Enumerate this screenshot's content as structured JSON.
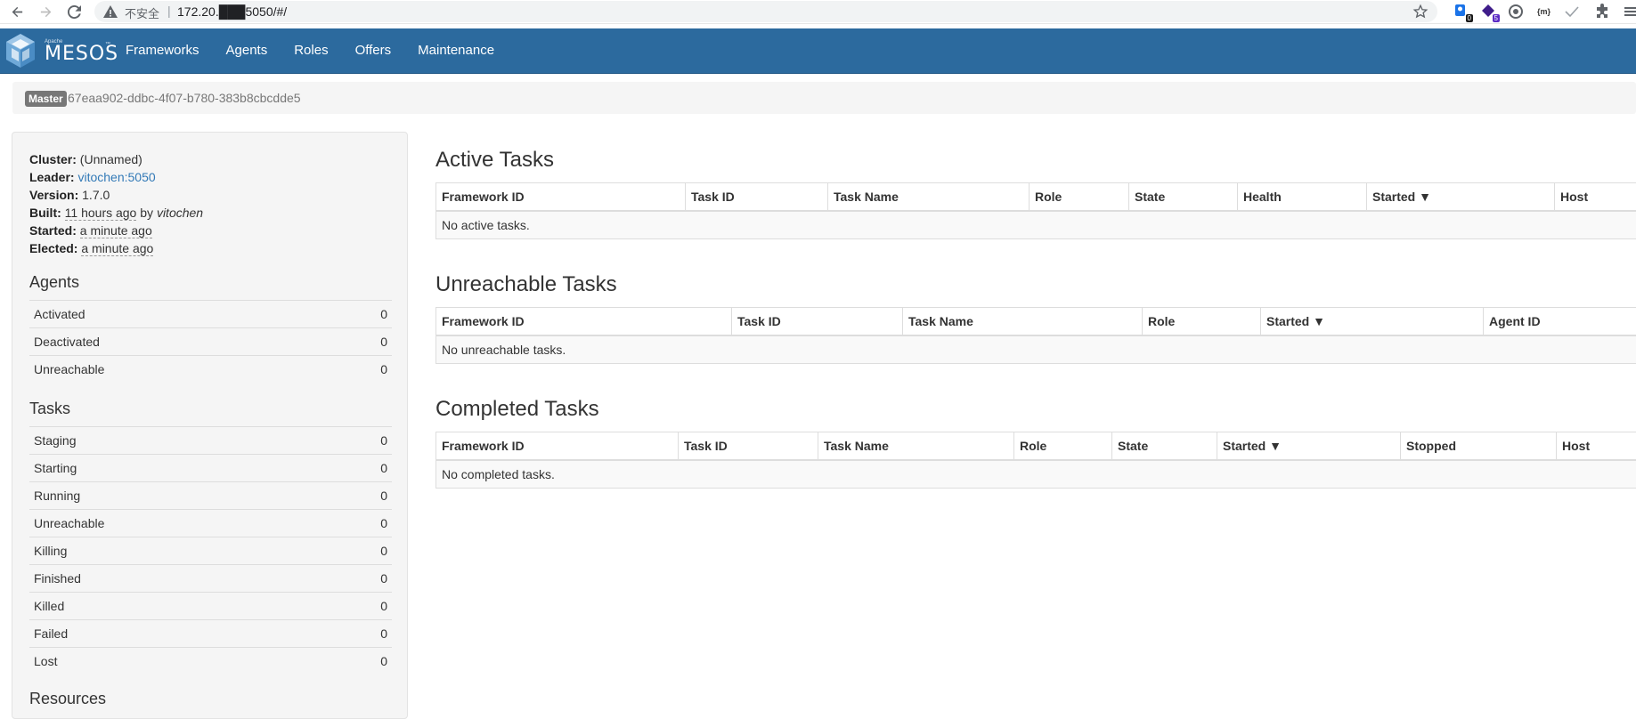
{
  "browser": {
    "insecure_label": "不安全",
    "url": "172.20.███5050/#/",
    "extensions": [
      {
        "icon": "extension-blue-icon",
        "badge": "0"
      },
      {
        "icon": "extension-purple-icon",
        "badge": "5"
      },
      {
        "icon": "extension-circle-icon"
      },
      {
        "icon": "extension-braces-icon",
        "text": "{m}"
      },
      {
        "icon": "extension-check-icon"
      },
      {
        "icon": "puzzle-icon"
      },
      {
        "icon": "menu-icon"
      }
    ]
  },
  "navbar": {
    "brand_apache": "Apache",
    "brand": "MESOS",
    "brand_tm": "™",
    "links": [
      "Frameworks",
      "Agents",
      "Roles",
      "Offers",
      "Maintenance"
    ]
  },
  "breadcrumb": {
    "label": "Master",
    "master_id": "67eaa902-ddbc-4f07-b780-383b8cbcdde5"
  },
  "sidebar": {
    "cluster_label": "Cluster:",
    "cluster_value": "(Unnamed)",
    "leader_label": "Leader:",
    "leader_value": "vitochen:5050",
    "version_label": "Version:",
    "version_value": "1.7.0",
    "built_label": "Built:",
    "built_time": "11 hours ago",
    "built_by": "by",
    "built_user": "vitochen",
    "started_label": "Started:",
    "started_value": "a minute ago",
    "elected_label": "Elected:",
    "elected_value": "a minute ago",
    "agents_title": "Agents",
    "agents": [
      {
        "label": "Activated",
        "value": "0"
      },
      {
        "label": "Deactivated",
        "value": "0"
      },
      {
        "label": "Unreachable",
        "value": "0"
      }
    ],
    "tasks_title": "Tasks",
    "tasks": [
      {
        "label": "Staging",
        "value": "0"
      },
      {
        "label": "Starting",
        "value": "0"
      },
      {
        "label": "Running",
        "value": "0"
      },
      {
        "label": "Unreachable",
        "value": "0"
      },
      {
        "label": "Killing",
        "value": "0"
      },
      {
        "label": "Finished",
        "value": "0"
      },
      {
        "label": "Killed",
        "value": "0"
      },
      {
        "label": "Failed",
        "value": "0"
      },
      {
        "label": "Lost",
        "value": "0"
      }
    ],
    "resources_title": "Resources"
  },
  "active": {
    "title": "Active Tasks",
    "headers": [
      "Framework ID",
      "Task ID",
      "Task Name",
      "Role",
      "State",
      "Health",
      "Started ▼",
      "Host"
    ],
    "empty": "No active tasks."
  },
  "unreachable": {
    "title": "Unreachable Tasks",
    "headers": [
      "Framework ID",
      "Task ID",
      "Task Name",
      "Role",
      "Started ▼",
      "Agent ID"
    ],
    "empty": "No unreachable tasks."
  },
  "completed": {
    "title": "Completed Tasks",
    "headers": [
      "Framework ID",
      "Task ID",
      "Task Name",
      "Role",
      "State",
      "Started ▼",
      "Stopped",
      "Host"
    ],
    "empty": "No completed tasks."
  }
}
